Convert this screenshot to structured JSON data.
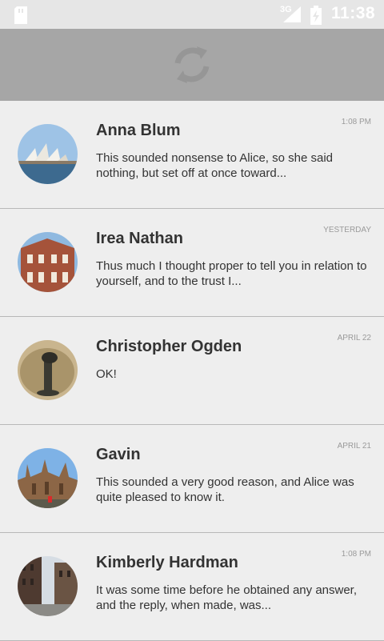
{
  "status_bar": {
    "network": "3G",
    "time": "11:38",
    "icons": [
      "sd-card-icon",
      "signal-icon",
      "battery-charging-icon"
    ]
  },
  "refresh": {
    "icon": "refresh-icon"
  },
  "conversations": [
    {
      "name": "Anna Blum",
      "time": "1:08 PM",
      "message": "This sounded nonsense to Alice, so she said nothing, but set off at once toward..."
    },
    {
      "name": "Irea Nathan",
      "time": "YESTERDAY",
      "message": "Thus much I thought proper to tell you in relation to yourself, and to the trust I..."
    },
    {
      "name": "Christopher Ogden",
      "time": "APRIL 22",
      "message": "OK!"
    },
    {
      "name": "Gavin",
      "time": "APRIL 21",
      "message": "This sounded a very good reason, and Alice was quite pleased to know it."
    },
    {
      "name": "Kimberly Hardman",
      "time": "1:08 PM",
      "message": "It was some time before he obtained any answer, and the reply, when made, was..."
    }
  ]
}
